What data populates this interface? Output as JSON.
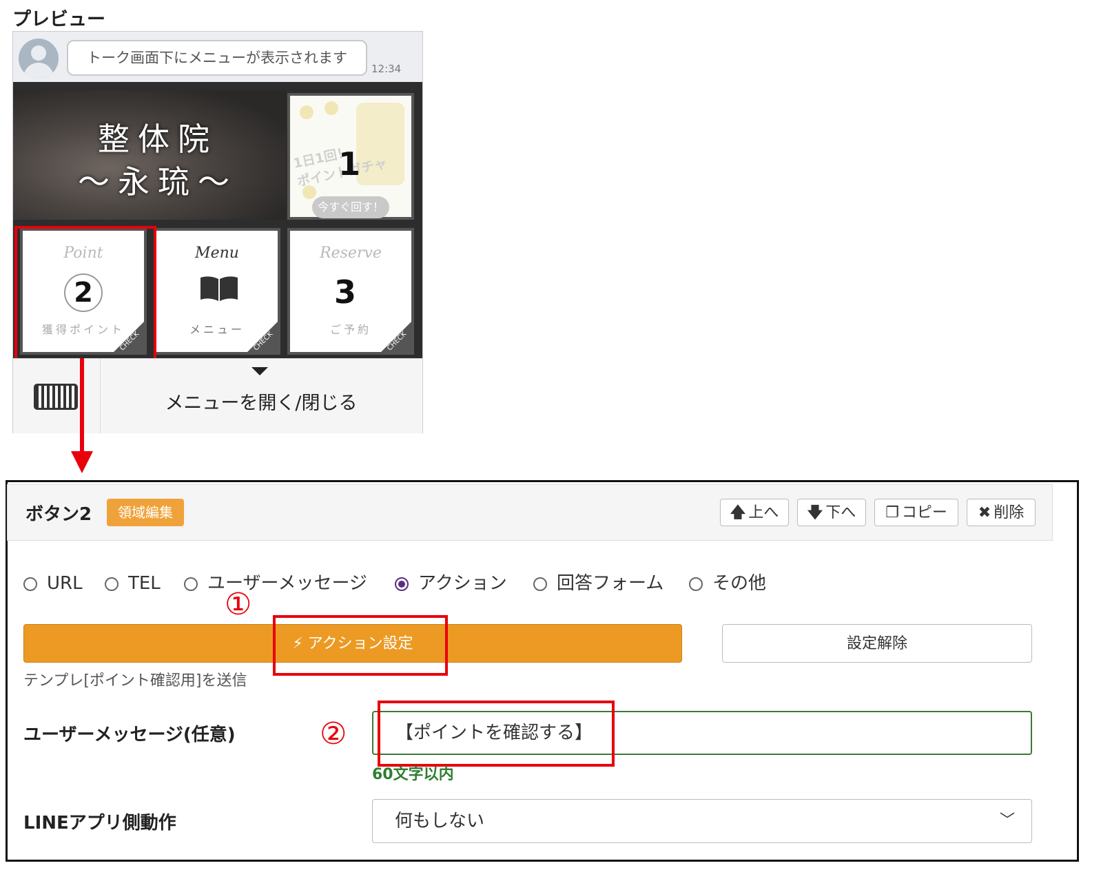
{
  "preview": {
    "title": "プレビュー",
    "chat_message": "トーク画面下にメニューが表示されます",
    "chat_time": "12:34",
    "banner": {
      "line1": "整体院",
      "line2": "〜永琉〜"
    },
    "tile1": {
      "promo": "1日1回！\nポイントガチャ",
      "number": "1",
      "button": "今すぐ回す！"
    },
    "tile2": {
      "script": "Point",
      "number": "2",
      "label": "獲得ポイント",
      "corner": "CHECK"
    },
    "tile_menu": {
      "script": "Menu",
      "label": "メニュー",
      "corner": "CHECK"
    },
    "tile3": {
      "script": "Reserve",
      "number": "3",
      "label": "ご予約",
      "corner": "CHECK"
    },
    "menu_toggle": "メニューを開く/閉じる"
  },
  "editor": {
    "button_title": "ボタン2",
    "area_edit": "領域編集",
    "up": "上へ",
    "down": "下へ",
    "copy": "コピー",
    "delete": "削除",
    "icons": {
      "up": "arrow-up",
      "down": "arrow-down",
      "copy": "paste",
      "delete": "times"
    },
    "types": [
      {
        "label": "URL",
        "selected": false
      },
      {
        "label": "TEL",
        "selected": false
      },
      {
        "label": "ユーザーメッセージ",
        "selected": false
      },
      {
        "label": "アクション",
        "selected": true
      },
      {
        "label": "回答フォーム",
        "selected": false
      },
      {
        "label": "その他",
        "selected": false
      }
    ],
    "action_setting": "アクション設定",
    "unset": "設定解除",
    "status": "テンプレ[ポイント確認用]を送信",
    "user_message_label": "ユーザーメッセージ(任意)",
    "user_message_value": "【ポイントを確認する】",
    "char_limit": "60文字以内",
    "line_action_label": "LINEアプリ側動作",
    "line_action_value": "何もしない"
  },
  "annotations": {
    "one": "①",
    "two": "②"
  },
  "colors": {
    "accent_orange": "#ec9a23",
    "highlight_red": "#e8000b",
    "radio_purple": "#5a2d82",
    "valid_green": "#2e7d32"
  }
}
